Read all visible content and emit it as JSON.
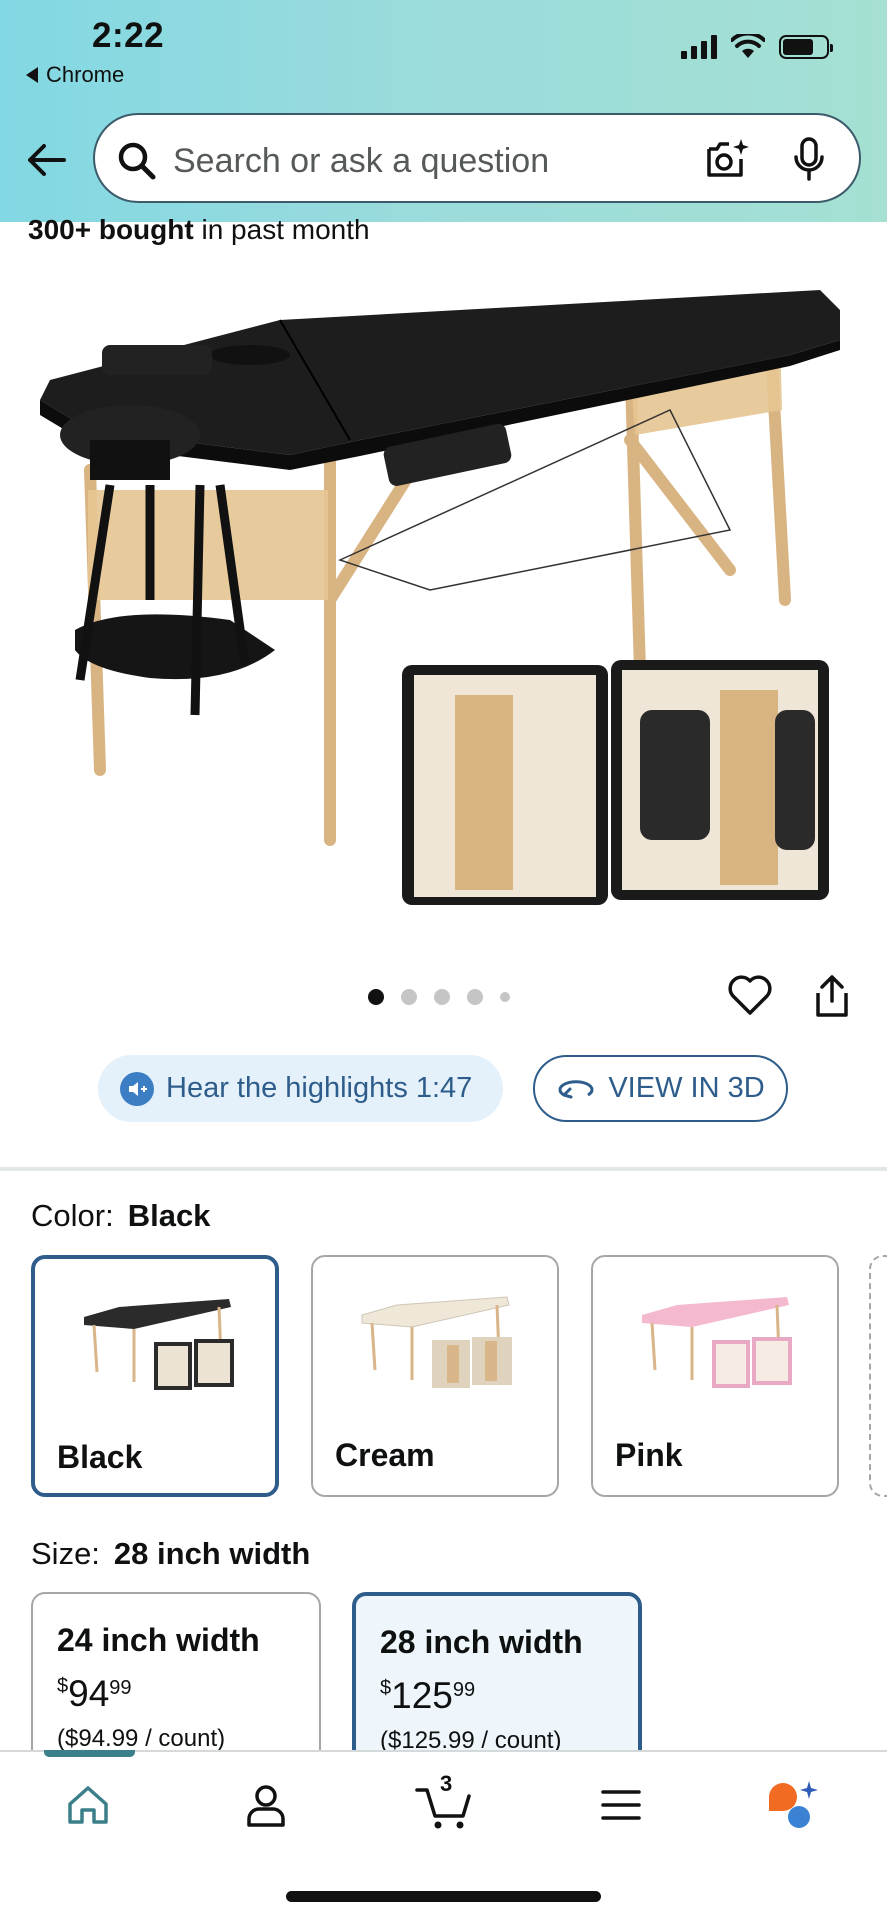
{
  "status_bar": {
    "time": "2:22",
    "back_app": "Chrome"
  },
  "search": {
    "placeholder": "Search or ask a question"
  },
  "product": {
    "bought_bold": "300+ bought",
    "bought_rest": " in past month",
    "image_count": 5,
    "active_image": 1
  },
  "actions": {
    "hear_label": "Hear the highlights 1:47",
    "view3d_label": "VIEW IN 3D"
  },
  "color": {
    "label": "Color:",
    "selected": "Black",
    "options": [
      {
        "label": "Black",
        "top": "#2b2b2b",
        "accent": "#d9b58a"
      },
      {
        "label": "Cream",
        "top": "#f1ebe0",
        "accent": "#d9b58a"
      },
      {
        "label": "Pink",
        "top": "#f4b8cf",
        "accent": "#e7a9c4"
      }
    ]
  },
  "size": {
    "label": "Size:",
    "selected": "28 inch width",
    "options": [
      {
        "title": "24 inch width",
        "dollar": "$",
        "whole": "94",
        "cents": "99",
        "unit": "($94.99 / count)"
      },
      {
        "title": "28 inch width",
        "dollar": "$",
        "whole": "125",
        "cents": "99",
        "unit": "($125.99 / count)"
      }
    ]
  },
  "nav": {
    "cart_count": "3",
    "items": [
      "home-icon",
      "account-icon",
      "cart-icon",
      "menu-icon",
      "rufus-icon"
    ]
  },
  "colors": {
    "accent": "#2f5d8b",
    "header_teal": "#9adbdc",
    "nav_active": "#3b7f8a"
  }
}
